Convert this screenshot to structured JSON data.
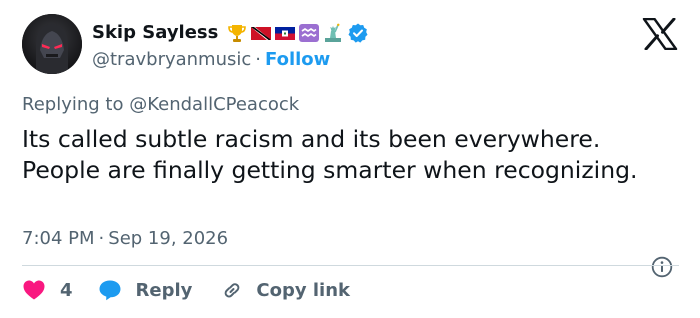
{
  "user": {
    "display_name": "Skip Sayless",
    "handle": "@travbryanmusic",
    "separator": "·",
    "follow_label": "Follow",
    "badges": [
      "trophy-icon",
      "trinidad-flag-icon",
      "haiti-flag-icon",
      "aquarius-icon",
      "statue-of-liberty-icon"
    ],
    "verified": true
  },
  "tweet": {
    "replying_prefix": "Replying to",
    "replying_to": "@KendallCPeacock",
    "text": "Its called subtle racism and its been everywhere. People are finally getting smarter when recognizing.",
    "time": "7:04 PM",
    "separator": "·",
    "date": "Sep 19, 2026"
  },
  "actions": {
    "like_count": "4",
    "reply_label": "Reply",
    "copy_label": "Copy link"
  },
  "colors": {
    "accent": "#1d9bf0",
    "like": "#f91880",
    "text": "#0f1419",
    "muted": "#536471",
    "divider": "#cfd9de"
  },
  "icons": [
    "x-logo-icon",
    "info-icon",
    "heart-icon",
    "reply-bubble-icon",
    "link-icon",
    "verified-badge-icon"
  ]
}
